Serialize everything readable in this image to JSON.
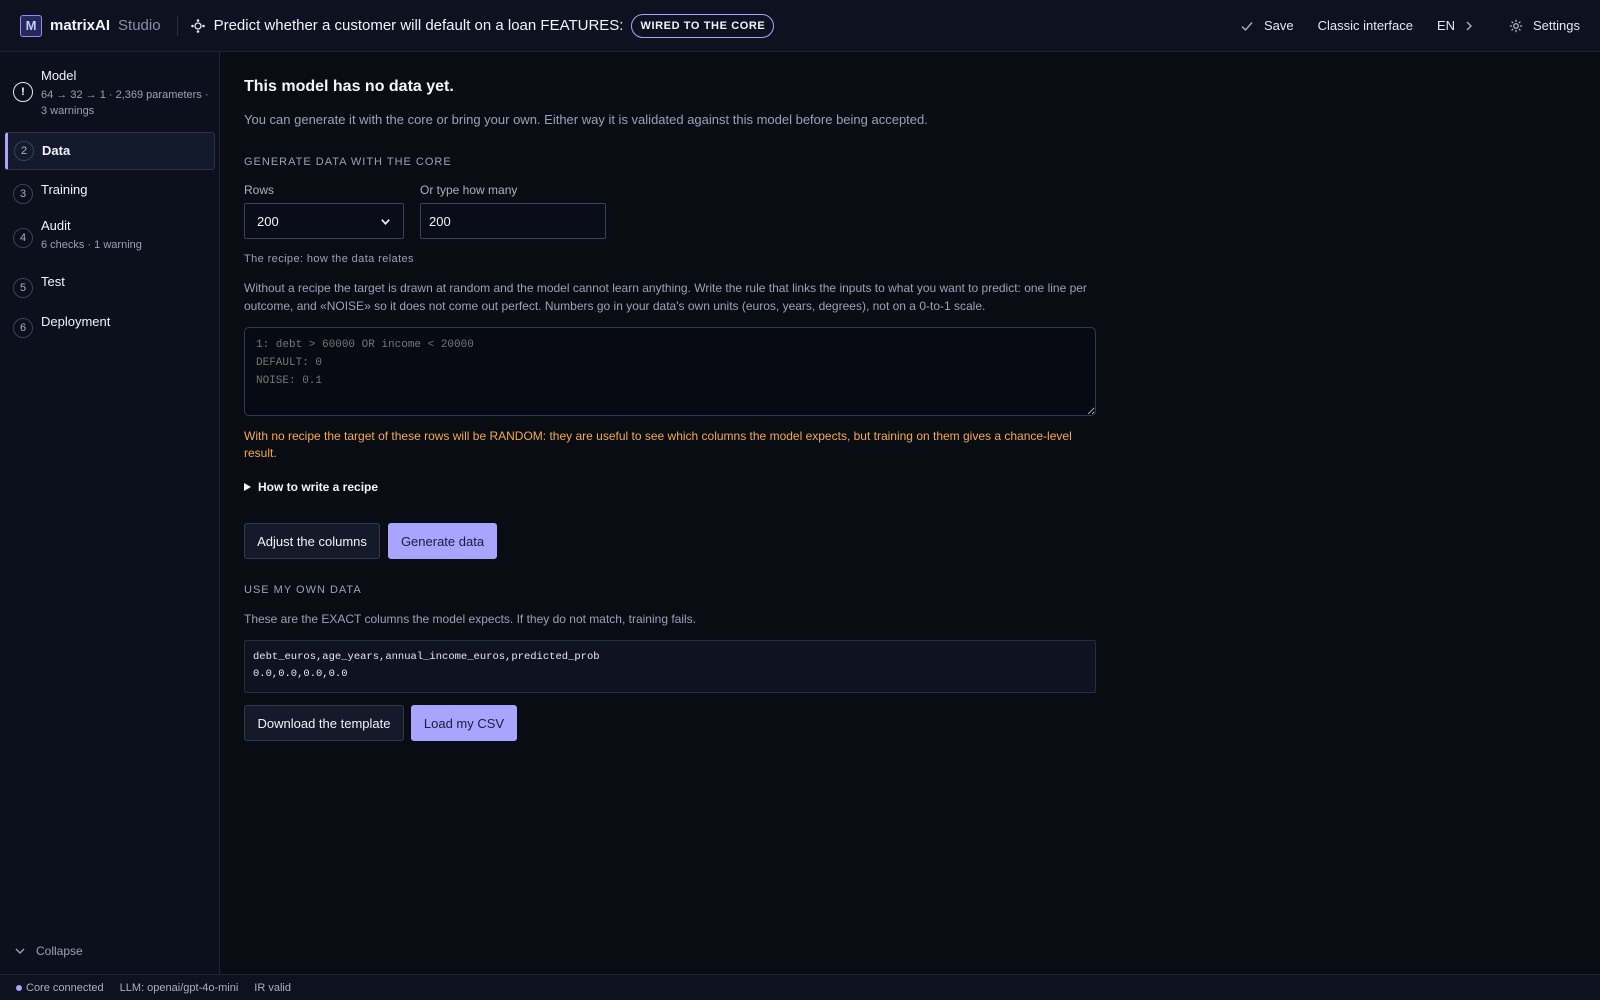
{
  "header": {
    "logo_letter": "M",
    "brand": "matrixAI",
    "brand_sub": "Studio",
    "title": "Predict whether a customer will default on a loan FEATURES:",
    "badge": "WIRED TO THE CORE",
    "save_label": "Save",
    "classic_label": "Classic interface",
    "lang": "EN",
    "settings_label": "Settings"
  },
  "sidebar": {
    "steps": [
      {
        "num": "!",
        "label": "Model",
        "sub": "64 → 32 → 1 · 2,369 parameters · 3 warnings",
        "state": "warning"
      },
      {
        "num": "2",
        "label": "Data",
        "sub": "",
        "state": "active"
      },
      {
        "num": "3",
        "label": "Training",
        "sub": "",
        "state": "idle"
      },
      {
        "num": "4",
        "label": "Audit",
        "sub": "6 checks · 1 warning",
        "state": "idle"
      },
      {
        "num": "5",
        "label": "Test",
        "sub": "",
        "state": "idle"
      },
      {
        "num": "6",
        "label": "Deployment",
        "sub": "",
        "state": "idle"
      }
    ],
    "collapse_label": "Collapse"
  },
  "main": {
    "heading": "This model has no data yet.",
    "lead": "You can generate it with the core or bring your own. Either way it is validated against this model before being accepted.",
    "generate_section": "GENERATE DATA WITH THE CORE",
    "rows_label": "Rows",
    "rows_value": "200",
    "custom_label": "Or type how many",
    "custom_value": "200",
    "recipe_title": "The recipe: how the data relates",
    "recipe_help": "Without a recipe the target is drawn at random and the model cannot learn anything. Write the rule that links the inputs to what you want to predict: one line per outcome, and «NOISE» so it does not come out perfect. Numbers go in your data's own units (euros, years, degrees), not on a 0-to-1 scale.",
    "recipe_placeholder": "1: debt > 60000 OR income < 20000\nDEFAULT: 0\nNOISE: 0.1",
    "warning": "With no recipe the target of these rows will be RANDOM: they are useful to see which columns the model expects, but training on them gives a chance-level result.",
    "howto_label": "How to write a recipe",
    "adjust_label": "Adjust the columns",
    "generate_label": "Generate data",
    "own_section": "USE MY OWN DATA",
    "own_help": "These are the EXACT columns the model expects. If they do not match, training fails.",
    "csv_header": "debt_euros,age_years,annual_income_euros,predicted_prob",
    "csv_row": "0.0,0.0,0.0,0.0",
    "download_label": "Download the template",
    "load_label": "Load my CSV"
  },
  "status": {
    "core": "Core connected",
    "llm": "LLM: openai/gpt-4o-mini",
    "ir": "IR valid"
  },
  "colors": {
    "accent": "#a8a4ff",
    "warning": "#f0a94a",
    "background": "#0a0c14"
  }
}
